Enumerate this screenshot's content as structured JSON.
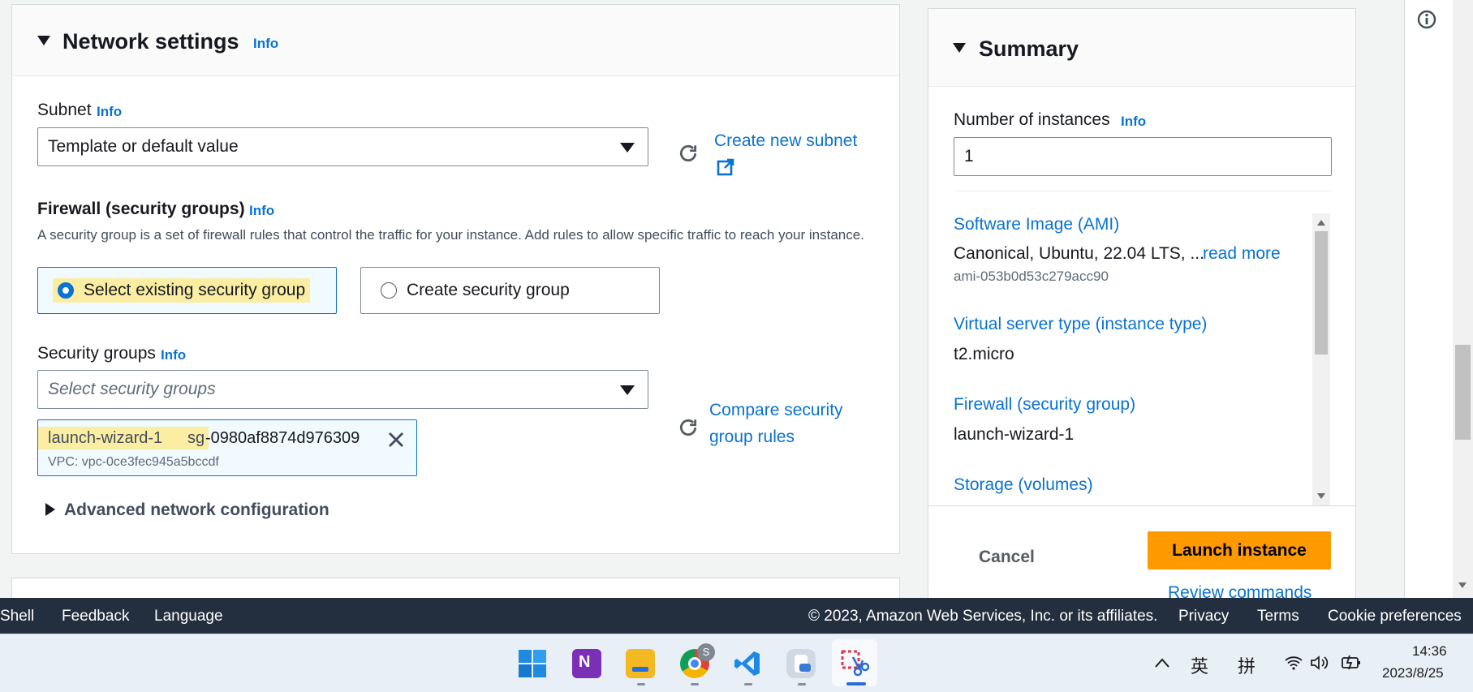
{
  "network": {
    "title": "Network settings",
    "info": "Info",
    "subnet": {
      "label": "Subnet",
      "info": "Info",
      "value": "Template or default value",
      "create_link": "Create new subnet"
    },
    "firewall": {
      "label": "Firewall (security groups)",
      "info": "Info",
      "description": "A security group is a set of firewall rules that control the traffic for your instance. Add rules to allow specific traffic to reach your instance.",
      "option_existing": "Select existing security group",
      "option_create": "Create security group"
    },
    "security_groups": {
      "label": "Security groups",
      "info": "Info",
      "placeholder": "Select security groups",
      "compare_link_1": "Compare security",
      "compare_link_2": "group rules",
      "token_name": "launch-wizard-1",
      "token_sg_prefix": "sg",
      "token_sg_id": "-0980af8874d976309",
      "token_vpc": "VPC: vpc-0ce3fec945a5bccdf"
    },
    "advanced": "Advanced network configuration"
  },
  "summary": {
    "title": "Summary",
    "instances_label": "Number of instances",
    "instances_info": "Info",
    "instances_value": "1",
    "ami_label": "Software Image (AMI)",
    "ami_value": "Canonical, Ubuntu, 22.04 LTS, ...",
    "ami_read_more": "read more",
    "ami_id": "ami-053b0d53c279acc90",
    "type_label": "Virtual server type (instance type)",
    "type_value": "t2.micro",
    "firewall_label": "Firewall (security group)",
    "firewall_value": "launch-wizard-1",
    "storage_label": "Storage (volumes)",
    "cancel": "Cancel",
    "launch": "Launch instance",
    "review": "Review commands"
  },
  "footer": {
    "shell": "Shell",
    "feedback": "Feedback",
    "language": "Language",
    "copyright": "© 2023, Amazon Web Services, Inc. or its affiliates.",
    "privacy": "Privacy",
    "terms": "Terms",
    "cookies": "Cookie preferences"
  },
  "taskbar": {
    "ime_lang": "英",
    "ime_mode": "拼",
    "time": "14:36",
    "date": "2023/8/25",
    "chrome_badge": "S"
  },
  "colors": {
    "accent": "#0972d3",
    "launch": "#ff9900",
    "footer_bg": "#232f3e",
    "highlight": "#fbeea2"
  }
}
